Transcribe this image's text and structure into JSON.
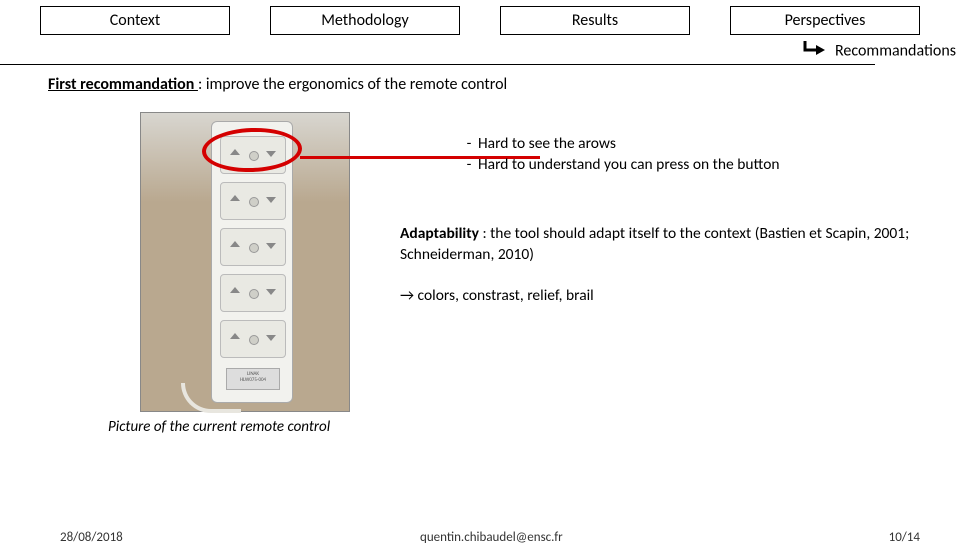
{
  "tabs": {
    "context": "Context",
    "methodology": "Methodology",
    "results": "Results",
    "perspectives": "Perspectives"
  },
  "subheader": "Recommandations",
  "first_rec": {
    "lead": "First recommandation ",
    "rest": ": improve the ergonomics of the remote control"
  },
  "bullets": [
    "Hard to see the arows",
    "Hard to understand you can press on the button"
  ],
  "adaptability": {
    "label": "Adaptability",
    "text": " : the tool should adapt itself to the context (Bastien et Scapin, 2001; Schneiderman, 2010)"
  },
  "arrow_line": "→ colors, constrast, relief, brail",
  "caption": "Picture of the current remote control",
  "remote_label": {
    "line1": "LINAK",
    "line2": "HLW075-004"
  },
  "footer": {
    "date": "28/08/2018",
    "email": "quentin.chibaudel@ensc.fr",
    "page": "10/14"
  }
}
